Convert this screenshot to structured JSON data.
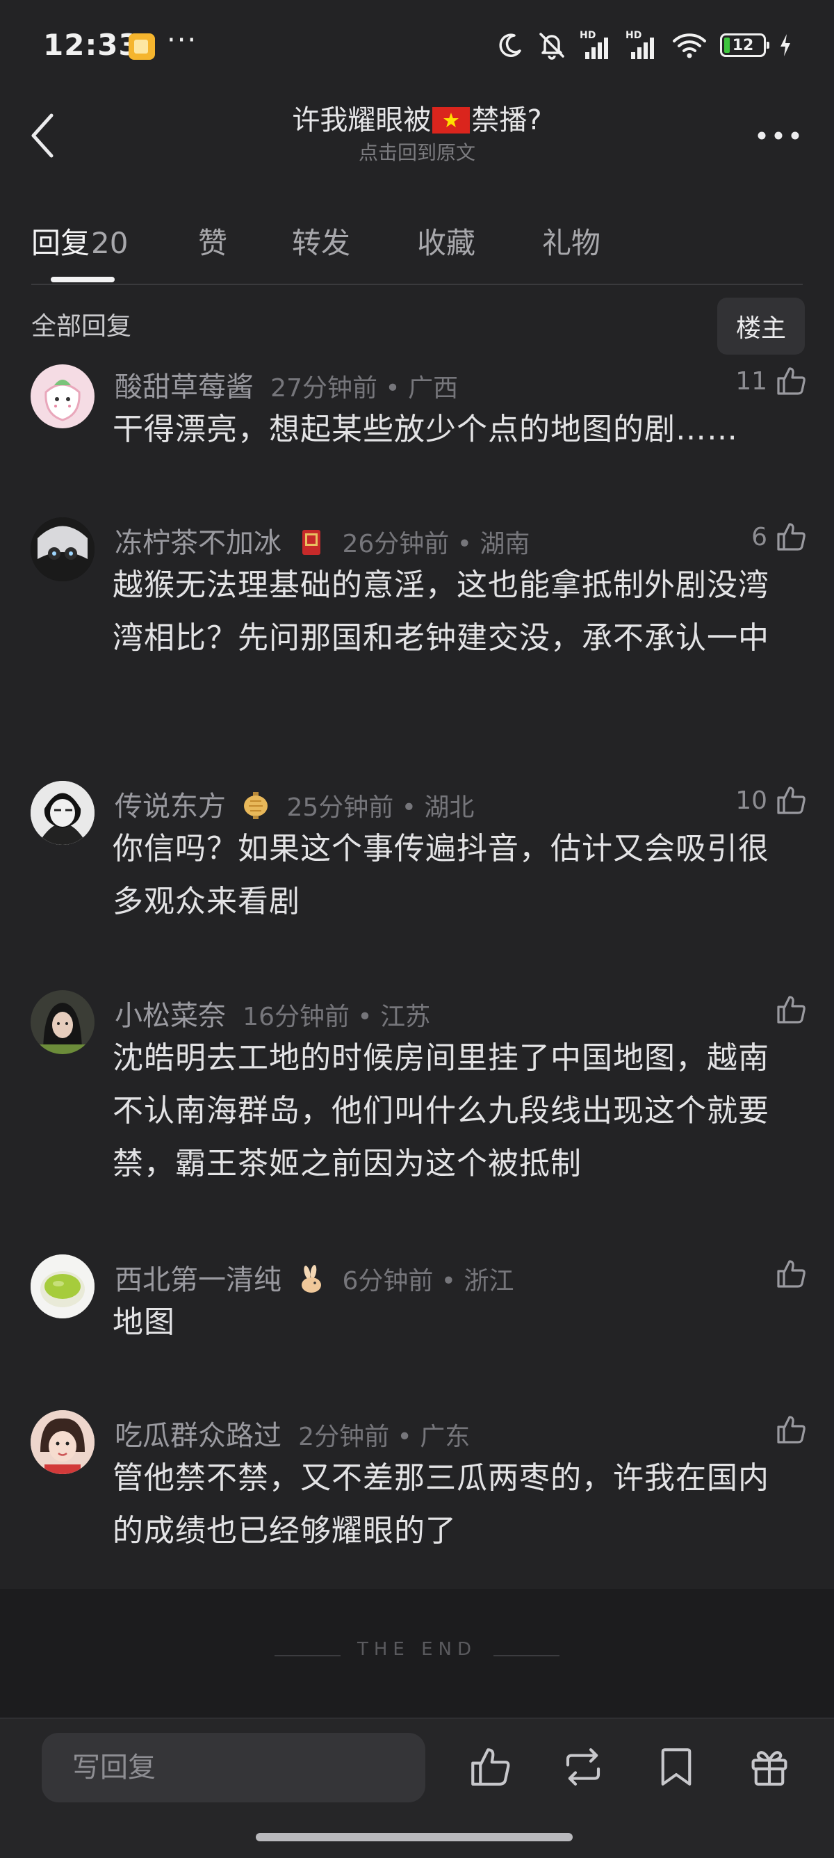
{
  "status_bar": {
    "time": "12:33",
    "dots": "···",
    "battery": "12"
  },
  "header": {
    "title_prefix": "许我耀眼被",
    "title_suffix": "禁播?",
    "subtitle": "点击回到原文"
  },
  "tabs": [
    {
      "label": "回复",
      "count": "20"
    },
    {
      "label": "赞"
    },
    {
      "label": "转发"
    },
    {
      "label": "收藏"
    },
    {
      "label": "礼物"
    }
  ],
  "section": {
    "title": "全部回复",
    "op_button": "楼主"
  },
  "comments": [
    {
      "name": "酸甜草莓酱",
      "time": "27分钟前",
      "location": "广西",
      "likes": "11",
      "text": "干得漂亮，想起某些放少个点的地图的剧……"
    },
    {
      "name": "冻柠茶不加冰",
      "time": "26分钟前",
      "location": "湖南",
      "likes": "6",
      "text": "越猴无法理基础的意淫，这也能拿抵制外剧没湾湾相比？先问那国和老钟建交没，承不承认一中"
    },
    {
      "name": "传说东方",
      "time": "25分钟前",
      "location": "湖北",
      "likes": "10",
      "text": "你信吗？如果这个事传遍抖音，估计又会吸引很多观众来看剧"
    },
    {
      "name": "小松菜奈",
      "time": "16分钟前",
      "location": "江苏",
      "likes": "",
      "text": "沈皓明去工地的时候房间里挂了中国地图，越南不认南海群岛，他们叫什么九段线出现这个就要禁，霸王茶姬之前因为这个被抵制"
    },
    {
      "name": "西北第一清纯",
      "time": "6分钟前",
      "location": "浙江",
      "likes": "",
      "text": "地图"
    },
    {
      "name": "吃瓜群众路过",
      "time": "2分钟前",
      "location": "广东",
      "likes": "",
      "text": "管他禁不禁，又不差那三瓜两枣的，许我在国内的成绩也已经够耀眼的了"
    }
  ],
  "end_text": "THE END",
  "bottom_bar": {
    "reply_placeholder": "写回复",
    "icons": [
      "like-icon",
      "repost-icon",
      "bookmark-icon",
      "gift-icon"
    ]
  },
  "colors": {
    "background": "#232325",
    "text_primary": "#e3e3e5",
    "text_secondary": "#9a9aa0",
    "flag_red": "#da251d",
    "flag_star": "#ffdf00"
  }
}
